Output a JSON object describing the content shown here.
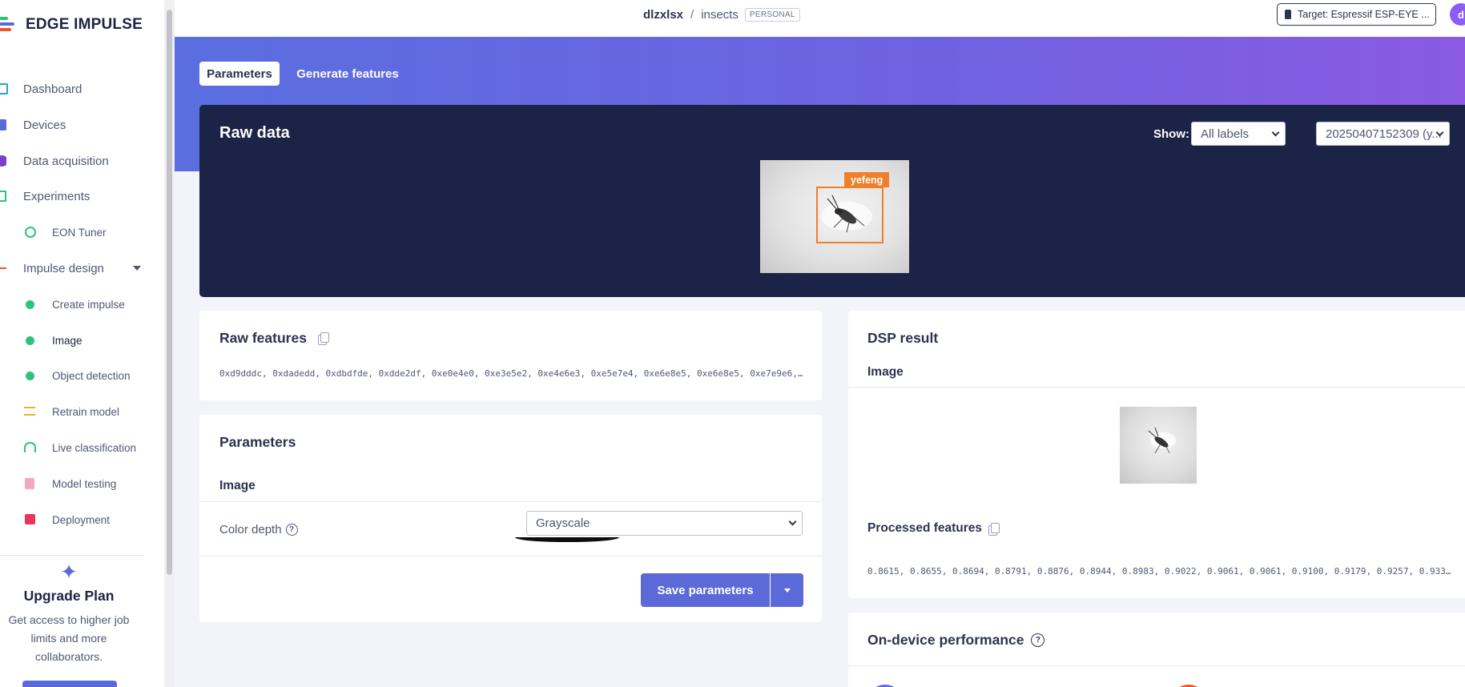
{
  "brand": {
    "name": "EDGE IMPULSE"
  },
  "sidebar": {
    "items": [
      {
        "label": "Dashboard",
        "icon": "monitor-icon",
        "color": "#1ea7c4"
      },
      {
        "label": "Devices",
        "icon": "chip-icon",
        "color": "#5b6ad8"
      },
      {
        "label": "Data acquisition",
        "icon": "database-icon",
        "color": "#7a3fd1"
      },
      {
        "label": "Experiments",
        "icon": "flask-grid-icon",
        "color": "#2fc27c"
      },
      {
        "label": "EON Tuner",
        "icon": "compass-icon",
        "color": "#2fc27c"
      },
      {
        "label": "Impulse design",
        "icon": "pulse-icon",
        "color": "#f0532a"
      },
      {
        "label": "Create impulse",
        "icon": "dot-icon",
        "color": "#2fc27c"
      },
      {
        "label": "Image",
        "icon": "dot-icon",
        "color": "#2fc27c"
      },
      {
        "label": "Object detection",
        "icon": "dot-icon",
        "color": "#2fc27c"
      },
      {
        "label": "Retrain model",
        "icon": "shuffle-icon",
        "color": "#e8b820"
      },
      {
        "label": "Live classification",
        "icon": "nodes-icon",
        "color": "#2fc27c"
      },
      {
        "label": "Model testing",
        "icon": "clipboard-icon",
        "color": "#e86a8c"
      },
      {
        "label": "Deployment",
        "icon": "cube-icon",
        "color": "#e8365a"
      }
    ]
  },
  "upgrade": {
    "title": "Upgrade Plan",
    "desc": "Get access to higher job limits and more collaborators."
  },
  "header": {
    "owner": "dlzxlsx",
    "separator": "/",
    "project": "insects",
    "badge": "PERSONAL",
    "target": "Target: Espressif ESP-EYE ...",
    "avatar": "d"
  },
  "tabs": {
    "active": "Parameters",
    "inactive": "Generate features"
  },
  "raw_data": {
    "title": "Raw data",
    "show_label": "Show:",
    "label_filter": "All labels",
    "sample": "20250407152309 (y...",
    "bbox_label": "yefeng"
  },
  "raw_features": {
    "title": "Raw features",
    "values": "0xd9dddc, 0xdadedd, 0xdbdfde, 0xdde2df, 0xe0e4e0, 0xe3e5e2, 0xe4e6e3, 0xe5e7e4, 0xe6e8e5, 0xe6e8e5, 0xe7e9e6,…"
  },
  "parameters": {
    "title": "Parameters",
    "section": "Image",
    "color_depth_label": "Color depth",
    "color_depth_value": "Grayscale",
    "save_label": "Save parameters"
  },
  "dsp_result": {
    "title": "DSP result",
    "section": "Image",
    "processed_title": "Processed features",
    "processed_values": "0.8615, 0.8655, 0.8694, 0.8791, 0.8876, 0.8944, 0.8983, 0.9022, 0.9061, 0.9061, 0.9100, 0.9179, 0.9257, 0.933…"
  },
  "performance": {
    "title": "On-device performance"
  }
}
